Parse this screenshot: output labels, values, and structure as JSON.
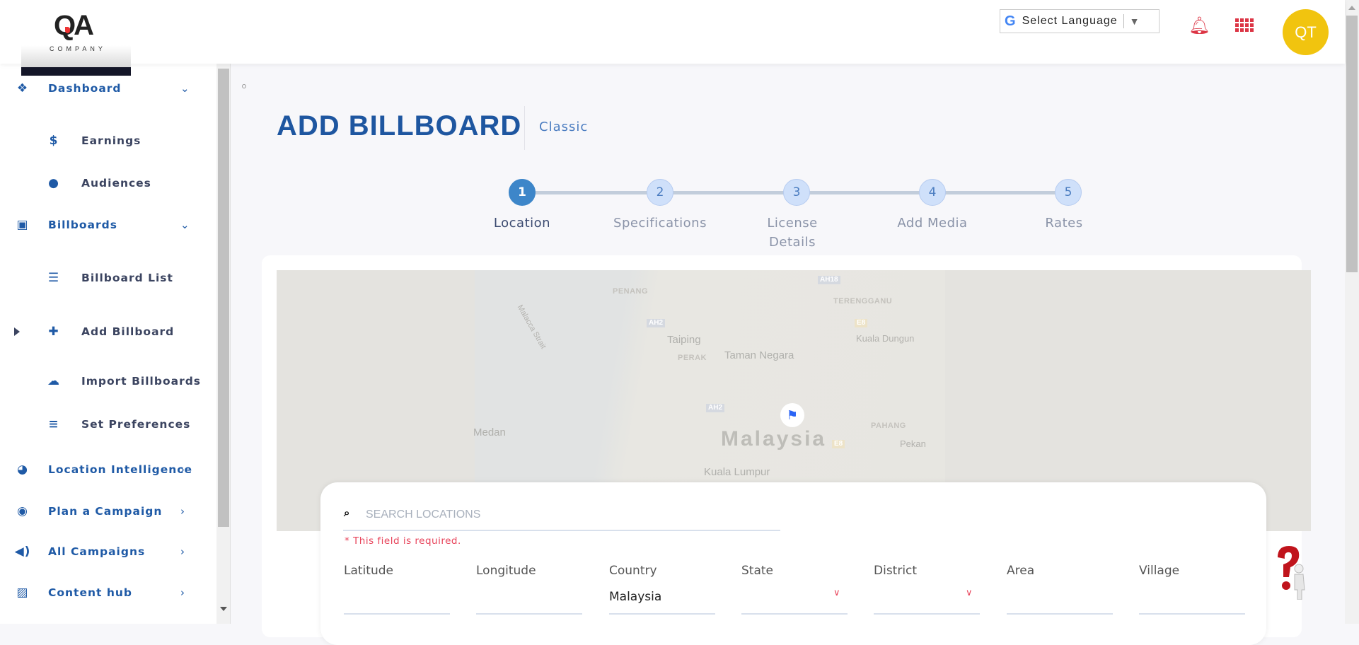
{
  "header": {
    "logo_text": "QA",
    "logo_sub": "COMPANY",
    "language_select": "Select Language",
    "avatar_initials": "QT",
    "brand_color": "#1e56a0",
    "alert_color": "#dc3545",
    "avatar_color": "#f1c40f"
  },
  "sidebar": {
    "items": [
      {
        "label": "Dashboard",
        "icon": "cubes-icon",
        "level": "top",
        "chevron": "⌄"
      },
      {
        "label": "Earnings",
        "icon": "dollar-icon",
        "level": "sub"
      },
      {
        "label": "Audiences",
        "icon": "user-icon",
        "level": "sub"
      },
      {
        "label": "Billboards",
        "icon": "billboard-icon",
        "level": "top",
        "chevron": "⌄"
      },
      {
        "label": "Billboard List",
        "icon": "list-icon",
        "level": "sub"
      },
      {
        "label": "Add Billboard",
        "icon": "plus-icon",
        "level": "sub",
        "active": true
      },
      {
        "label": "Import Billboards",
        "icon": "cloud-upload-icon",
        "level": "sub"
      },
      {
        "label": "Set Preferences",
        "icon": "sliders-icon",
        "level": "sub"
      },
      {
        "label": "Location Intelligence",
        "icon": "globe-icon",
        "level": "top",
        "chevron": "›"
      },
      {
        "label": "Plan a Campaign",
        "icon": "target-icon",
        "level": "top",
        "chevron": "›"
      },
      {
        "label": "All Campaigns",
        "icon": "speaker-icon",
        "level": "top",
        "chevron": "›"
      },
      {
        "label": "Content hub",
        "icon": "image-icon",
        "level": "top",
        "chevron": "›"
      }
    ]
  },
  "page": {
    "title": "ADD BILLBOARD",
    "subtitle": "Classic"
  },
  "stepper": {
    "current": 1,
    "steps": [
      {
        "num": "1",
        "label": "Location"
      },
      {
        "num": "2",
        "label": "Specifications"
      },
      {
        "num": "3",
        "label": "License Details"
      },
      {
        "num": "4",
        "label": "Add Media"
      },
      {
        "num": "5",
        "label": "Rates"
      }
    ]
  },
  "map": {
    "labels": {
      "penang": "PENANG",
      "strait": "Malacca Strait",
      "ah2a": "AH2",
      "taiping": "Taiping",
      "perak": "PERAK",
      "taman": "Taman Negara",
      "terengganu": "TERENGGANU",
      "e8a": "E8",
      "dungun": "Kuala Dungun",
      "ah2b": "AH2",
      "medan": "Medan",
      "malaysia": "Malaysia",
      "e8b": "E8",
      "pahang": "PAHANG",
      "pekan": "Pekan",
      "kl": "Kuala Lumpur",
      "ah18": "AH18"
    }
  },
  "form": {
    "search_placeholder": "SEARCH LOCATIONS",
    "search_value": "",
    "error": "* This field is required.",
    "fields": [
      {
        "label": "Latitude",
        "value": ""
      },
      {
        "label": "Longitude",
        "value": ""
      },
      {
        "label": "Country",
        "value": "Malaysia"
      },
      {
        "label": "State",
        "value": "",
        "dropdown": true
      },
      {
        "label": "District",
        "value": "",
        "dropdown": true
      },
      {
        "label": "Area",
        "value": ""
      },
      {
        "label": "Village",
        "value": ""
      }
    ]
  }
}
